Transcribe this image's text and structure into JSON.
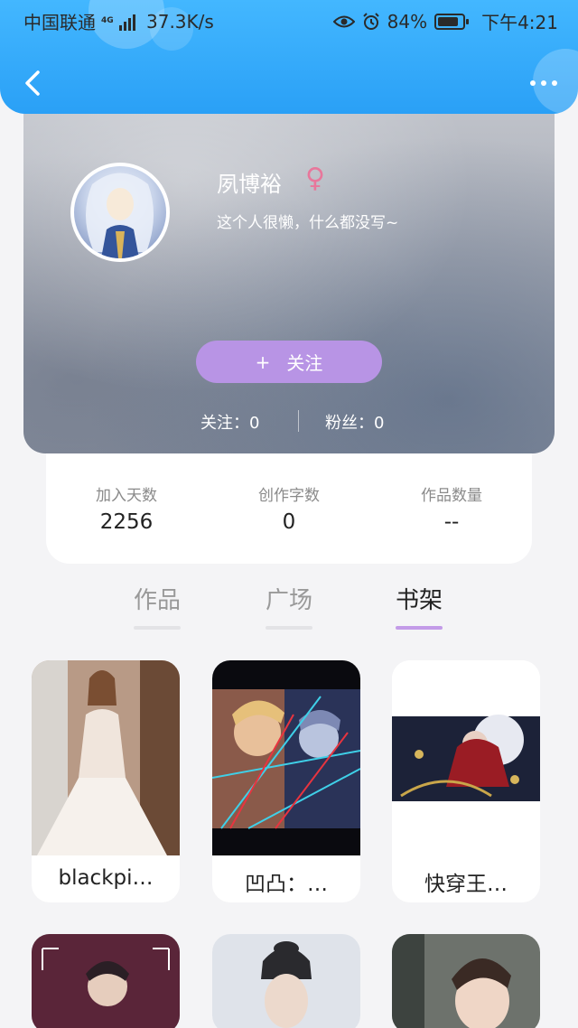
{
  "status_bar": {
    "carrier": "中国联通",
    "network": "4G",
    "speed": "37.3K/s",
    "battery": "84%",
    "time": "下午4:21"
  },
  "nav": {
    "back_icon": "chevron-left-icon",
    "more_icon": "more-dots-icon"
  },
  "profile": {
    "name": "夙博裕",
    "gender_symbol": "♀",
    "bio": "这个人很懒，什么都没写~",
    "follow_plus": "+",
    "follow_label": "关注",
    "following": "关注：0",
    "fans": "粉丝：0"
  },
  "info": [
    {
      "label": "加入天数",
      "value": "2256"
    },
    {
      "label": "创作字数",
      "value": "0"
    },
    {
      "label": "作品数量",
      "value": "--"
    }
  ],
  "tabs": [
    {
      "label": "作品",
      "active": false
    },
    {
      "label": "广场",
      "active": false
    },
    {
      "label": "书架",
      "active": true
    }
  ],
  "books": [
    {
      "title": "blackpi…"
    },
    {
      "title": "凹凸：…"
    },
    {
      "title": "快穿王…"
    }
  ],
  "colors": {
    "header": "#2aa0f6",
    "follow_button": "#b894e5",
    "active_tab_underline": "#c39be8",
    "gender": "#e8779b"
  }
}
